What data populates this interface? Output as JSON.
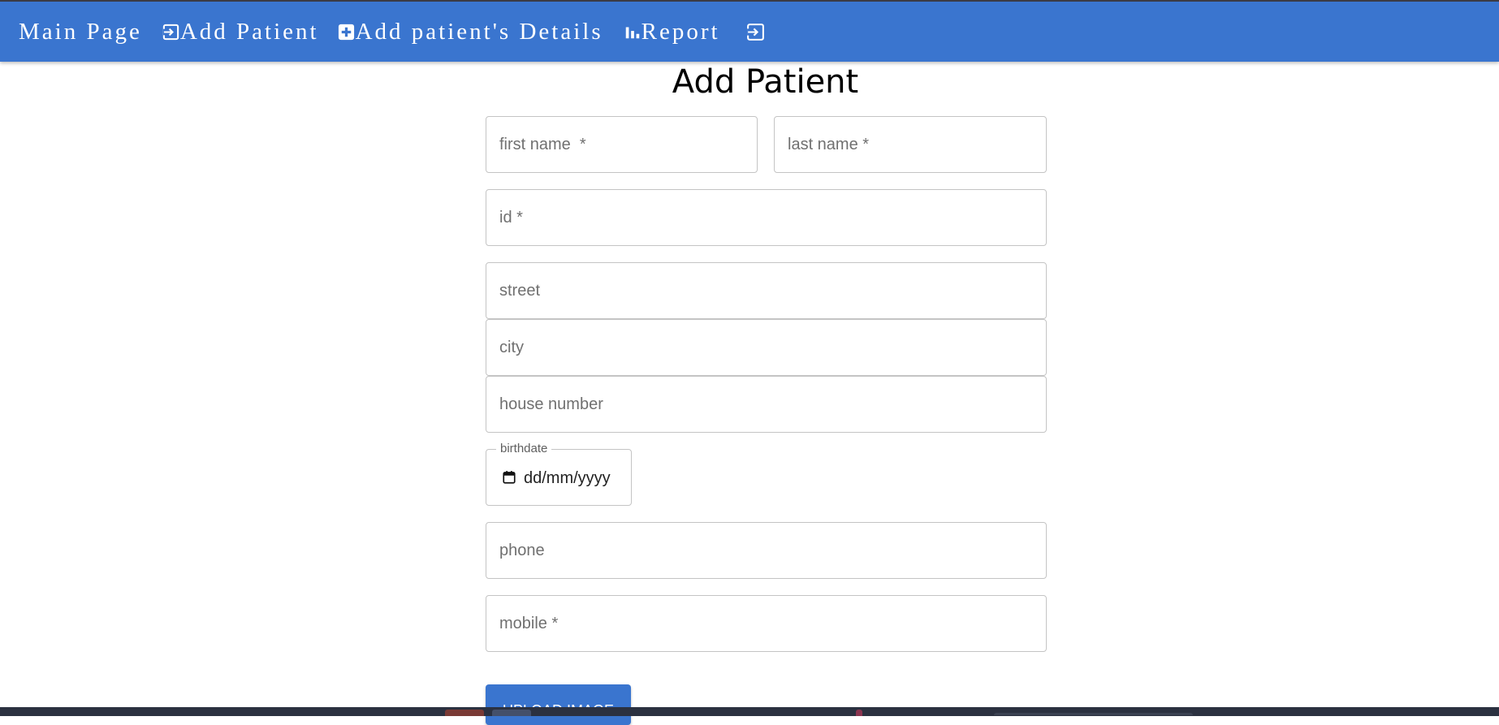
{
  "nav": {
    "main_page": "Main Page",
    "add_patient": "Add Patient",
    "add_details": "Add patient's Details",
    "report": "Report"
  },
  "page": {
    "title": "Add Patient"
  },
  "form": {
    "first_name": {
      "placeholder": "first name  *"
    },
    "last_name": {
      "placeholder": "last name *"
    },
    "id": {
      "placeholder": "id *"
    },
    "street": {
      "placeholder": "street"
    },
    "city": {
      "placeholder": "city"
    },
    "house_number": {
      "placeholder": "house number"
    },
    "birthdate": {
      "label": "birthdate",
      "value": "dd/mm/yyyy"
    },
    "phone": {
      "placeholder": "phone"
    },
    "mobile": {
      "placeholder": "mobile *"
    },
    "upload_label": "UPLOAD IMAGE"
  },
  "colors": {
    "appbar": "#3a75cf",
    "taskbar": "#2b3140"
  },
  "icons": {
    "add_patient": "login-arrow-icon",
    "add_details": "plus-box-icon",
    "report": "bar-chart-icon",
    "logout": "logout-arrow-icon",
    "date": "calendar-icon"
  }
}
